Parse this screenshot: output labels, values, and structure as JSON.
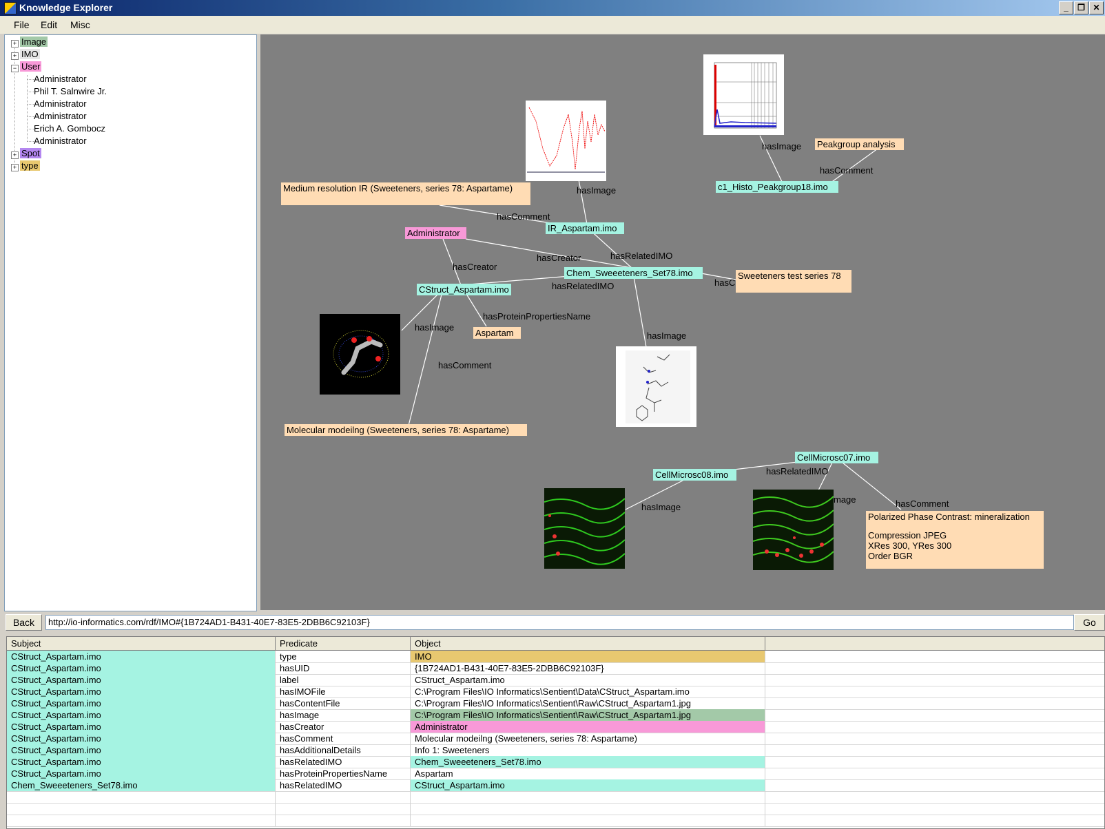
{
  "window": {
    "title": "Knowledge Explorer"
  },
  "menu": [
    "File",
    "Edit",
    "Misc"
  ],
  "colors": {
    "image": "#a3c9a8",
    "imo": "#a5f3e2",
    "user": "#f899d8",
    "spot": "#b487f0",
    "type": "#e8c870",
    "comment": "#ffdcb4",
    "graph_bg": "#808080"
  },
  "tree": {
    "image": "Image",
    "imo": "IMO",
    "user": "User",
    "users": [
      "Administrator",
      "Phil T. Salnwire Jr.",
      "Administrator",
      "Administrator",
      "Erich A. Gombocz",
      "Administrator"
    ],
    "spot": "Spot",
    "type": "type"
  },
  "graph": {
    "nodes": {
      "medium_ir": "Medium resolution IR (Sweeteners, series 78: Aspartame)",
      "peakgroup": "Peakgroup analysis",
      "c1_histo": "c1_Histo_Peakgroup18.imo",
      "ir_aspartam": "IR_Aspartam.imo",
      "administrator": "Administrator",
      "chem_set": "Chem_Sweeeteners_Set78.imo",
      "sweeteners_test": "Sweeteners test series 78",
      "cstruct": "CStruct_Aspartam.imo",
      "aspartam": "Aspartam",
      "molecular": "Molecular modeilng (Sweeteners, series 78: Aspartame)",
      "cellmicrosc07": "CellMicrosc07.imo",
      "cellmicrosc08": "CellMicrosc08.imo",
      "polarized": [
        "Polarized Phase Contrast: mineralization",
        "",
        "Compression JPEG",
        "XRes 300, YRes 300",
        "Order BGR"
      ]
    },
    "edges": {
      "e1": "hasImage",
      "e2": "hasImage",
      "e3": "hasComment",
      "e4": "hasComment",
      "e5": "hasRelatedIMO",
      "e6": "hasCreator",
      "e7": "hasCreator",
      "e8": "hasRelatedIMO",
      "e9": "hasC",
      "e10": "hasProteinPropertiesName",
      "e11": "hasImage",
      "e12": "hasImage",
      "e13": "hasComment",
      "e14": "hasRelatedIMO",
      "e15": "hasImage",
      "e16": "mage",
      "e17": "hasComment"
    }
  },
  "address": {
    "back": "Back",
    "url": "http://io-informatics.com/rdf/IMO#{1B724AD1-B431-40E7-83E5-2DBB6C92103F}",
    "go": "Go"
  },
  "table": {
    "headers": [
      "Subject",
      "Predicate",
      "Object"
    ],
    "rows": [
      [
        "CStruct_Aspartam.imo",
        "type",
        "IMO"
      ],
      [
        "CStruct_Aspartam.imo",
        "hasUID",
        "{1B724AD1-B431-40E7-83E5-2DBB6C92103F}"
      ],
      [
        "CStruct_Aspartam.imo",
        "label",
        "CStruct_Aspartam.imo"
      ],
      [
        "CStruct_Aspartam.imo",
        "hasIMOFile",
        "C:\\Program Files\\IO Informatics\\Sentient\\Data\\CStruct_Aspartam.imo"
      ],
      [
        "CStruct_Aspartam.imo",
        "hasContentFile",
        "C:\\Program Files\\IO Informatics\\Sentient\\Raw\\CStruct_Aspartam1.jpg"
      ],
      [
        "CStruct_Aspartam.imo",
        "hasImage",
        "C:\\Program Files\\IO Informatics\\Sentient\\Raw\\CStruct_Aspartam1.jpg"
      ],
      [
        "CStruct_Aspartam.imo",
        "hasCreator",
        "Administrator"
      ],
      [
        "CStruct_Aspartam.imo",
        "hasComment",
        "Molecular modeilng (Sweeteners, series 78: Aspartame)"
      ],
      [
        "CStruct_Aspartam.imo",
        "hasAdditionalDetails",
        "Info 1: Sweeteners"
      ],
      [
        "CStruct_Aspartam.imo",
        "hasRelatedIMO",
        "Chem_Sweeeteners_Set78.imo"
      ],
      [
        "CStruct_Aspartam.imo",
        "hasProteinPropertiesName",
        "Aspartam"
      ],
      [
        "Chem_Sweeeteners_Set78.imo",
        "hasRelatedIMO",
        "CStruct_Aspartam.imo"
      ]
    ],
    "object_colors": [
      "#e8c870",
      "",
      "",
      "",
      "",
      "#a3c9a8",
      "#f899d8",
      "",
      "",
      "#a5f3e2",
      "",
      "#a5f3e2"
    ]
  }
}
